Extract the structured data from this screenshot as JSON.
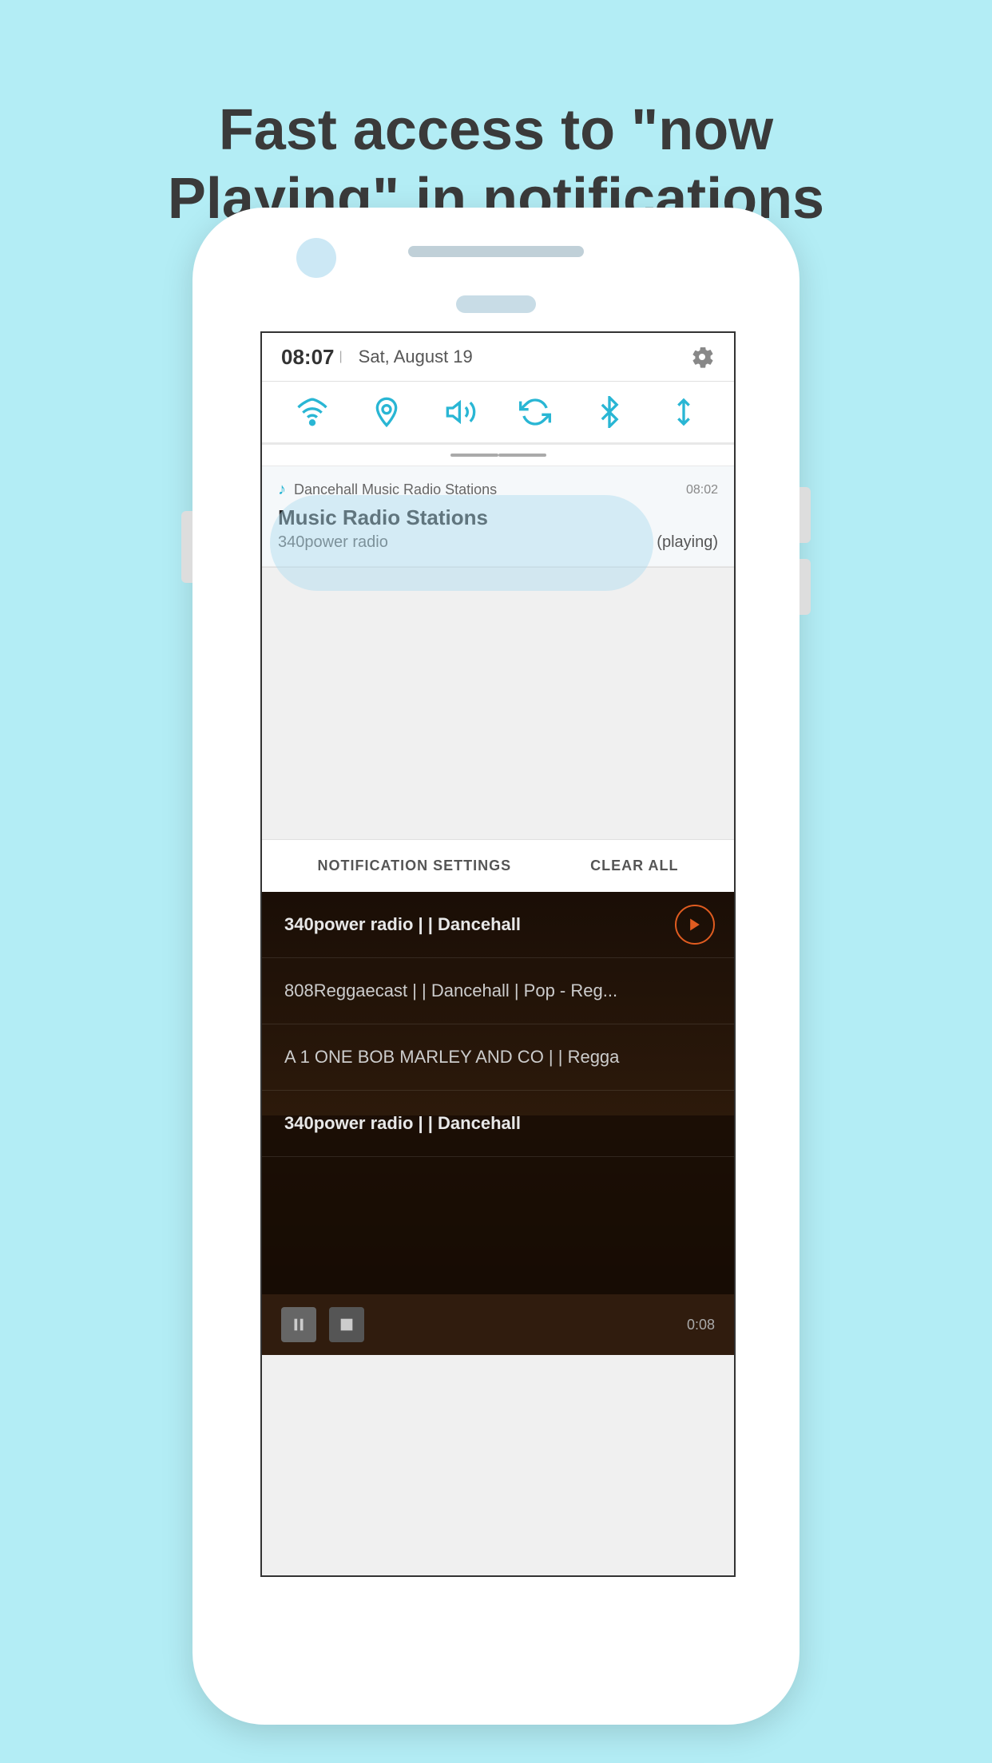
{
  "header": {
    "title": "Fast access to \"now Playing\" in notifications"
  },
  "phone": {
    "status_bar": {
      "time": "08:07",
      "separator": "|",
      "date": "Sat, August 19"
    },
    "quick_settings": {
      "icons": [
        "wifi",
        "location",
        "volume",
        "sync",
        "bluetooth",
        "transfer"
      ]
    },
    "notification": {
      "app_icon": "♪",
      "app_name": "Dancehall Music Radio Stations",
      "time": "08:02",
      "title": "Music Radio Stations",
      "station": "340power radio",
      "status": "(playing)"
    },
    "notification_bar": {
      "settings_label": "NOTIFICATION SETTINGS",
      "clear_label": "CLEAR ALL"
    },
    "station_list": [
      {
        "text": "340power radio | | Dancehall",
        "has_play": true
      },
      {
        "text": "808Reggaecast | | Dancehall | Pop - Reg...",
        "has_play": false
      },
      {
        "text": "A 1 ONE BOB MARLEY AND CO | | Regga",
        "has_play": false
      },
      {
        "text": "340power radio | | Dancehall",
        "has_play": false
      }
    ],
    "player": {
      "time": "0:08"
    }
  }
}
